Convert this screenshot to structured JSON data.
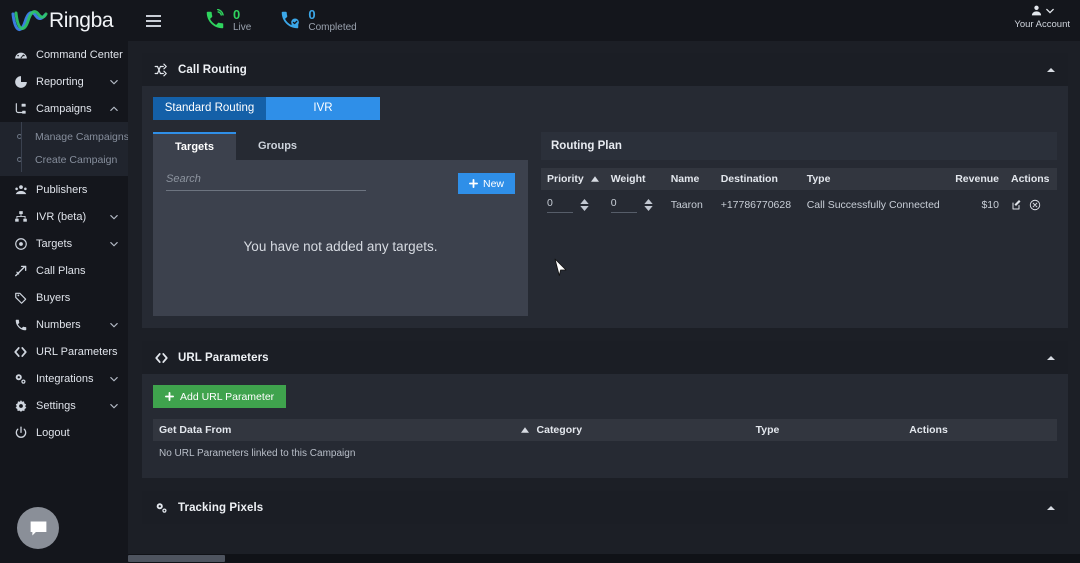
{
  "app": {
    "brand": "Ringba",
    "menu_icon": "hamburger-icon"
  },
  "header": {
    "counters": [
      {
        "value": "0",
        "label": "Live",
        "icon": "phone-ringing-icon",
        "color": "#2fd45e"
      },
      {
        "value": "0",
        "label": "Completed",
        "icon": "phone-check-icon",
        "color": "#3ba7e8"
      }
    ],
    "account": {
      "label": "Your Account",
      "icon": "user-icon",
      "caret": "chevron-down-icon"
    }
  },
  "sidebar": {
    "items": [
      {
        "label": "Command Center",
        "icon": "dashboard-icon",
        "expandable": false
      },
      {
        "label": "Reporting",
        "icon": "chart-pie-icon",
        "expandable": true,
        "expanded": false
      },
      {
        "label": "Campaigns",
        "icon": "campaign-icon",
        "expandable": true,
        "expanded": true,
        "children": [
          {
            "label": "Manage Campaigns"
          },
          {
            "label": "Create Campaign"
          }
        ]
      },
      {
        "label": "Publishers",
        "icon": "publishers-icon",
        "expandable": false
      },
      {
        "label": "IVR (beta)",
        "icon": "sitemap-icon",
        "expandable": true,
        "expanded": false
      },
      {
        "label": "Targets",
        "icon": "target-icon",
        "expandable": true,
        "expanded": false
      },
      {
        "label": "Call Plans",
        "icon": "trend-up-icon",
        "expandable": false
      },
      {
        "label": "Buyers",
        "icon": "tag-icon",
        "expandable": false
      },
      {
        "label": "Numbers",
        "icon": "phone-icon",
        "expandable": true,
        "expanded": false
      },
      {
        "label": "URL Parameters",
        "icon": "code-brackets-icon",
        "expandable": false
      },
      {
        "label": "Integrations",
        "icon": "gears-icon",
        "expandable": true,
        "expanded": false
      },
      {
        "label": "Settings",
        "icon": "gear-icon",
        "expandable": true,
        "expanded": false
      },
      {
        "label": "Logout",
        "icon": "power-icon",
        "expandable": false
      }
    ],
    "chat_widget": {
      "icon": "chat-bubble-icon"
    }
  },
  "call_routing": {
    "title": "Call Routing",
    "icon": "shuffle-icon",
    "collapse_icon": "caret-up-icon",
    "mode_tabs": [
      {
        "label": "Standard Routing",
        "selected": true,
        "color": "#1460a8"
      },
      {
        "label": "IVR",
        "selected": false,
        "color": "#2f8fe8"
      }
    ],
    "sub_tabs": [
      {
        "label": "Targets",
        "active": true
      },
      {
        "label": "Groups",
        "active": false
      }
    ],
    "search": {
      "placeholder": "Search",
      "value": ""
    },
    "new_button": {
      "label": "New",
      "icon": "plus-icon"
    },
    "empty_message": "You have not added any targets.",
    "routing_plan": {
      "title": "Routing Plan",
      "columns": [
        "Priority",
        "Weight",
        "Name",
        "Destination",
        "Type",
        "Revenue",
        "Actions"
      ],
      "sort_column": "Priority",
      "sort_direction": "asc",
      "rows": [
        {
          "priority": "0",
          "weight": "0",
          "name": "Taaron",
          "destination": "+17786770628",
          "type": "Call Successfully Connected",
          "revenue": "$10",
          "actions": [
            "edit-icon",
            "remove-icon"
          ]
        }
      ]
    }
  },
  "url_parameters": {
    "title": "URL Parameters",
    "icon": "code-brackets-icon",
    "collapse_icon": "caret-up-icon",
    "add_button": {
      "label": "Add URL Parameter",
      "icon": "plus-icon"
    },
    "columns": [
      "Get Data From",
      "Category",
      "Type",
      "Actions"
    ],
    "sort_column": "Category",
    "sort_direction": "asc",
    "empty_message": "No URL Parameters linked to this Campaign"
  },
  "tracking_pixels": {
    "title": "Tracking Pixels",
    "icon": "gears-icon",
    "collapse_icon": "caret-up-icon"
  },
  "colors": {
    "page_bg": "#1c1f26",
    "chrome_bg": "#14161c",
    "panel_bg": "#262a33",
    "panel_head_bg": "#1b1e25",
    "accent_blue": "#2f8fe8",
    "accent_blue_dark": "#1460a8",
    "accent_green": "#3fa34d",
    "live_green": "#2fd45e",
    "text_primary": "#e7eaf0",
    "text_muted": "#8d949f"
  }
}
